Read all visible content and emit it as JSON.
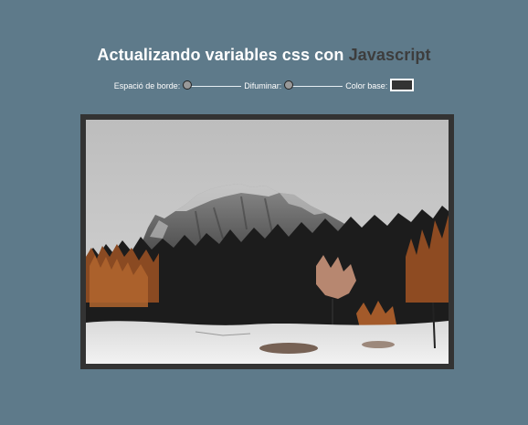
{
  "header": {
    "title_main": "Actualizando variables css con ",
    "title_accent": "Javascript"
  },
  "controls": {
    "spacing": {
      "label": "Espació de borde:",
      "value": 0
    },
    "blur": {
      "label": "Difuminar:",
      "value": 0
    },
    "base_color": {
      "label": "Color base:",
      "value": "#333333"
    }
  },
  "colors": {
    "background": "#5e7a8a",
    "accent": "#3d3d3d",
    "frame": "#333333"
  },
  "image": {
    "subject": "mountain-forest-snow-photo"
  }
}
